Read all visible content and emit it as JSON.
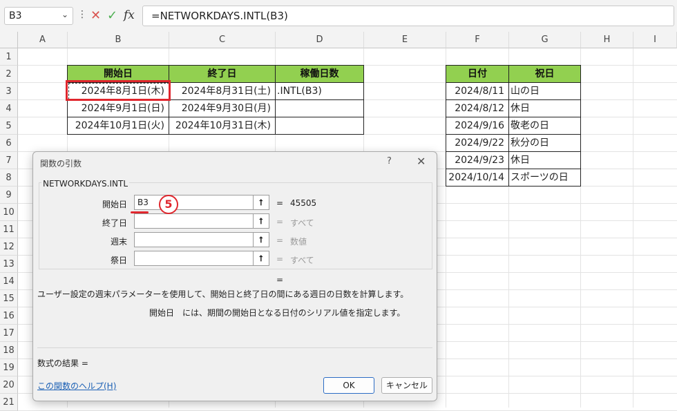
{
  "formula_bar": {
    "name_box": "B3",
    "formula": "=NETWORKDAYS.INTL(B3)",
    "cancel_symbol": "✕",
    "enter_symbol": "✓",
    "fx_label": "fx"
  },
  "columns": [
    "A",
    "B",
    "C",
    "D",
    "E",
    "F",
    "G",
    "H",
    "I"
  ],
  "rows": [
    "1",
    "2",
    "3",
    "4",
    "5",
    "6",
    "7",
    "8",
    "9",
    "10",
    "11",
    "12",
    "13",
    "14",
    "15",
    "16",
    "17",
    "18",
    "19",
    "20",
    "21"
  ],
  "table1": {
    "headers": [
      "開始日",
      "終了日",
      "稼働日数"
    ],
    "rows": [
      [
        "2024年8月1日(木)",
        "2024年8月31日(土)",
        ".INTL(B3)"
      ],
      [
        "2024年9月1日(日)",
        "2024年9月30日(月)",
        ""
      ],
      [
        "2024年10月1日(火)",
        "2024年10月31日(木)",
        ""
      ]
    ]
  },
  "table2": {
    "headers": [
      "日付",
      "祝日"
    ],
    "rows": [
      [
        "2024/8/11",
        "山の日"
      ],
      [
        "2024/8/12",
        "休日"
      ],
      [
        "2024/9/16",
        "敬老の日"
      ],
      [
        "2024/9/22",
        "秋分の日"
      ],
      [
        "2024/9/23",
        "休日"
      ],
      [
        "2024/10/14",
        "スポーツの日"
      ]
    ]
  },
  "dialog": {
    "title": "関数の引数",
    "help_symbol": "?",
    "close_symbol": "✕",
    "function_name": "NETWORKDAYS.INTL",
    "args": [
      {
        "label": "開始日",
        "value": "B3",
        "result": "45505",
        "result_grey": false
      },
      {
        "label": "終了日",
        "value": "",
        "result": "すべて",
        "result_grey": true
      },
      {
        "label": "週末",
        "value": "",
        "result": "数値",
        "result_grey": true
      },
      {
        "label": "祭日",
        "value": "",
        "result": "すべて",
        "result_grey": true
      }
    ],
    "equals": "=",
    "description": "ユーザー設定の週末パラメーターを使用して、開始日と終了日の間にある週日の日数を計算します。",
    "arg_description": "開始日　には、期間の開始日となる日付のシリアル値を指定します。",
    "result_label": "数式の結果 =",
    "help_link": "この関数のヘルプ(H)",
    "ok_label": "OK",
    "cancel_label": "キャンセル"
  },
  "annotation": {
    "step": "5"
  },
  "colors": {
    "header_green": "#92d050",
    "highlight_red": "#e0262d"
  }
}
